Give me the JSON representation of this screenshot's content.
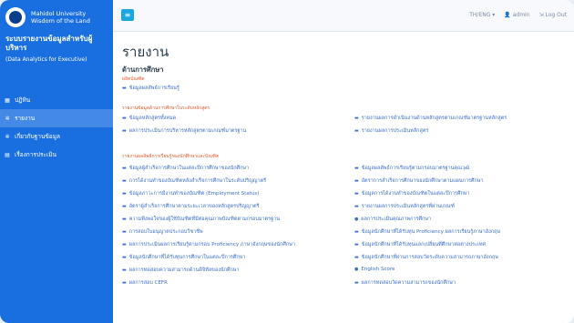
{
  "brand": {
    "university": "Mahidol University",
    "motto": "Wisdom of the Land"
  },
  "system": {
    "title_line1": "ระบบรายงานข้อมูลสำหรับผู้",
    "title_line2": "บริหาร",
    "subtitle": "(Data Analytics for Executive)"
  },
  "nav": [
    {
      "label": "ปฏิทิน"
    },
    {
      "label": "รายงาน"
    },
    {
      "label": "เกี่ยวกับฐานข้อมูล"
    },
    {
      "label": "เรื่องการประเมิน"
    }
  ],
  "topbar": {
    "menu": "≡",
    "lang": "TH/ENG",
    "user": "admin",
    "logout": "Log Out"
  },
  "page": {
    "title": "รายงาน",
    "section": "ด้านการศึกษา"
  },
  "groups": [
    {
      "title": "ผลิตบัณฑิต"
    },
    {
      "title": "รายงานข้อมูลด้านการศึกษาในระดับหลักสูตร"
    },
    {
      "title": "รายงานผลลัพธ์การเรียนรู้ของนักศึกษาและบัณฑิต"
    }
  ],
  "links": {
    "g1": [
      "ข้อมูลผลลัพธ์การเรียนรู้"
    ],
    "g2_left": [
      "ข้อมูลหลักสูตรทั้งหมด",
      "ผลการประเมินการบริหารหลักสูตรตามเกณฑ์มาตรฐาน"
    ],
    "g2_right": [
      "รายงานผลการดำเนินงานด้านหลักสูตรตามเกณฑ์มาตรฐานหลักสูตร",
      "รายงานผลการประเมินหลักสูตร"
    ],
    "g3_left": [
      "ข้อมูลผู้สำเร็จการศึกษาในแต่ละปีการศึกษาของนักศึกษา",
      "การได้งานทำของบัณฑิตหลังสำเร็จการศึกษาในระดับปริญญาตรี",
      "ข้อมูลภาวะการมีงานทำของบัณฑิต (Employment Status)",
      "อัตราผู้สำเร็จการศึกษาตามระยะเวลาของหลักสูตรปริญญาตรี",
      "ความพึงพอใจของผู้ใช้บัณฑิตที่มีต่อคุณภาพบัณฑิตตามกรอบมาตรฐาน",
      "การสอบใบอนุญาตประกอบวิชาชีพ",
      "ผลการประเมินผลการเรียนรู้ตามกรอบ Proficiency ภาษาอังกฤษของนักศึกษา",
      "ข้อมูลนักศึกษาที่ได้รับทุนการศึกษาในแต่ละปีการศึกษา",
      "ผลการทดสอบความสามารถด้านดิจิทัลของนักศึกษา",
      "ผลการสอบ CEFR"
    ],
    "g3_right": [
      "ข้อมูลผลลัพธ์การเรียนรู้ตามกรอบมาตรฐานคุณวุฒิ",
      "อัตราการสำเร็จการศึกษาของนักศึกษาตามแผนการศึกษา",
      "ข้อมูลการได้งานทำของบัณฑิตในแต่ละปีการศึกษา",
      "รายงานผลการประเมินหลักสูตรที่ผ่านเกณฑ์",
      "ผลการประเมินคุณภาพการศึกษา",
      "ข้อมูลนักศึกษาที่ได้รับทุน Proficiency ผลการเรียนรู้ภาษาอังกฤษ",
      "ข้อมูลนักศึกษาที่ได้รับทุนแลกเปลี่ยนที่ศึกษาต่อต่างประเทศ",
      "ข้อมูลนักศึกษาที่ผ่านการสอบวัดระดับความสามารถภาษาอังกฤษ",
      "English Score",
      "ผลการทดสอบวัดความสามารถของนักศึกษา"
    ]
  }
}
